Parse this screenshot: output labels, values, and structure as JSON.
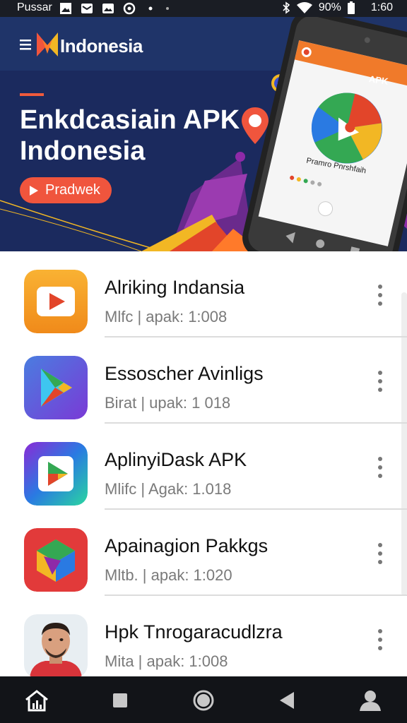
{
  "status_bar": {
    "carrier": "Pussar",
    "battery": "90%",
    "time": "1:60",
    "icons": [
      "image-icon",
      "email-icon",
      "gallery-icon",
      "sync-icon",
      "dot-icon",
      "dot-icon",
      "bluetooth-icon",
      "wifi-icon",
      "battery-icon"
    ]
  },
  "header": {
    "brand": "Indonesia",
    "icons": [
      "menu-icon",
      "logo-icon",
      "search-icon"
    ]
  },
  "hero": {
    "title": "Enkdcasiain APK Indonesia",
    "button_label": "Pradwek",
    "phone_label": "APK",
    "phone_caption": "Pramro Pnrshfaih",
    "accent_color": "#f0553d",
    "background_color": "#1b2a5e"
  },
  "apps": [
    {
      "title": "Alriking  Indansia",
      "subtitle": "Mlfc | apak: 1:008",
      "icon": "video-play-icon"
    },
    {
      "title": "Essoscher Avinligs",
      "subtitle": "Birat | upak: 1 018",
      "icon": "play-store-icon"
    },
    {
      "title": "AplinyiDask APK",
      "subtitle": "Mlifc | Agak: 1.018",
      "icon": "play-store-gradient-icon"
    },
    {
      "title": "Apainagion Pakkgs",
      "subtitle": "Mltb. | apak: 1:020",
      "icon": "maps-cube-icon"
    },
    {
      "title": "Hpk Tnrogaracudlzra",
      "subtitle": "Mita | apak: 1:008",
      "icon": "user-photo"
    }
  ],
  "navbar": {
    "icons": [
      "home-chart-icon",
      "square-icon",
      "circle-home-icon",
      "back-icon",
      "profile-icon"
    ]
  }
}
